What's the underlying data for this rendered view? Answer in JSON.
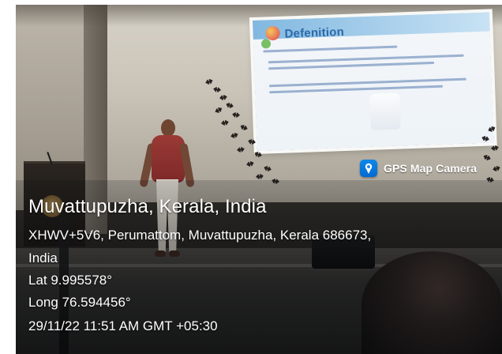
{
  "screen": {
    "title": "Defenition"
  },
  "watermark": {
    "app_name": "GPS Map Camera",
    "icon": "gps-map-camera-icon"
  },
  "location": {
    "title": "Muvattupuzha, Kerala, India",
    "address_line_1": "XHWV+5V6, Perumattom, Muvattupuzha, Kerala 686673,",
    "address_line_2": "India",
    "lat": "Lat 9.995578°",
    "long": "Long 76.594456°",
    "datetime": "29/11/22 11:51 AM GMT +05:30"
  }
}
